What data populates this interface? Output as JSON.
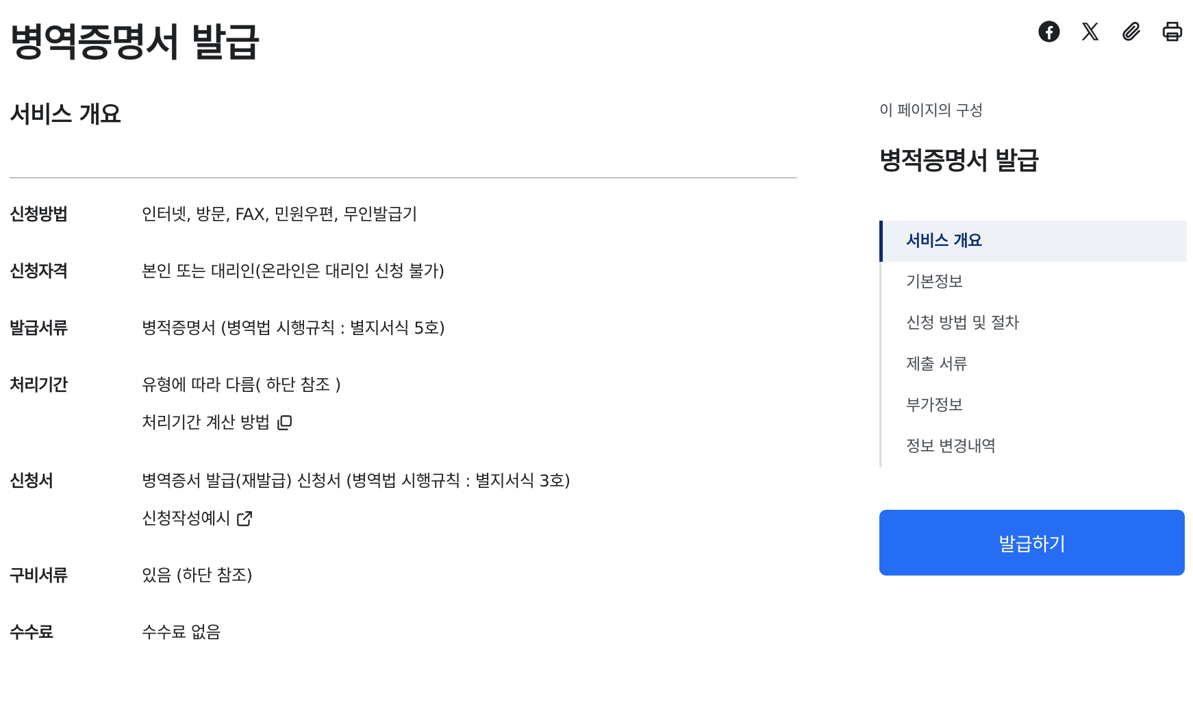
{
  "page": {
    "title": "병역증명서 발급"
  },
  "share": {
    "icons": [
      "facebook-icon",
      "x-twitter-icon",
      "paperclip-icon",
      "printer-icon"
    ]
  },
  "overview": {
    "title": "서비스 개요",
    "rows": [
      {
        "label": "신청방법",
        "value": "인터넷, 방문, FAX, 민원우편, 무인발급기"
      },
      {
        "label": "신청자격",
        "value": "본인 또는 대리인(온라인은 대리인 신청 불가)"
      },
      {
        "label": "발급서류",
        "value": "병적증명서 (병역법 시행규칙 : 별지서식 5호)"
      },
      {
        "label": "처리기간",
        "value": "유형에 따라 다름( 하단 참조 )",
        "link": "처리기간 계산 방법"
      },
      {
        "label": "신청서",
        "value": "병역증서 발급(재발급) 신청서 (병역법 시행규칙 : 별지서식 3호)",
        "link": "신청작성예시"
      },
      {
        "label": "구비서류",
        "value": "있음 (하단 참조)"
      },
      {
        "label": "수수료",
        "value": "수수료 없음"
      }
    ]
  },
  "toc": {
    "caption": "이 페이지의 구성",
    "title": "병적증명서 발급",
    "items": [
      "서비스 개요",
      "기본정보",
      "신청 방법 및 절차",
      "제출 서류",
      "부가정보",
      "정보 변경내역"
    ],
    "active_index": 0
  },
  "action": {
    "issue_label": "발급하기"
  },
  "colors": {
    "primary": "#256ef4",
    "navy": "#0b2d6f",
    "toc_active_bg": "#eef2f7",
    "text": "#1e2124"
  }
}
